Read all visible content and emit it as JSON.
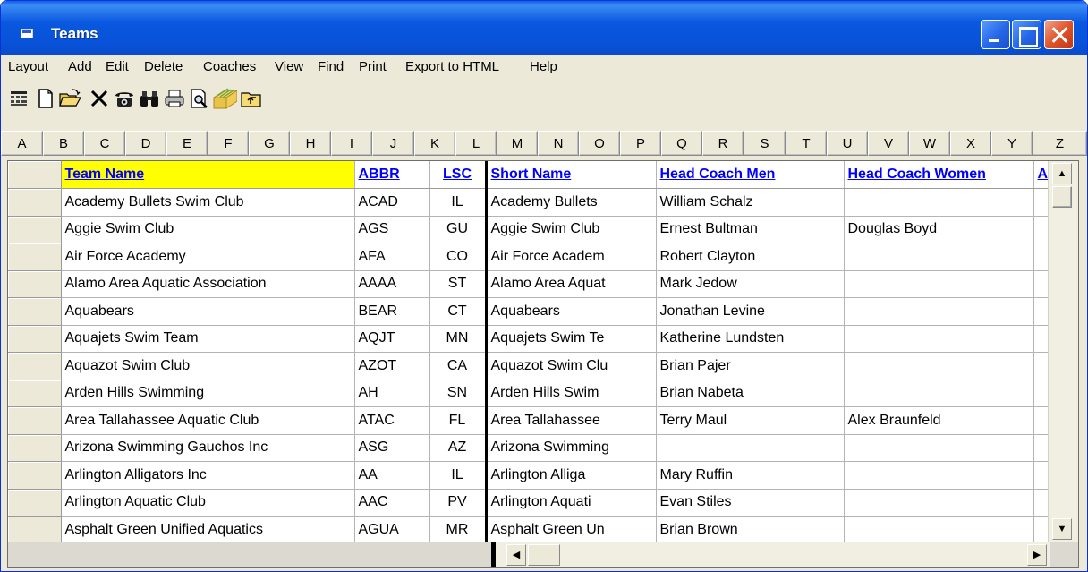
{
  "window": {
    "title": "Teams",
    "colors": {
      "title_bar": "#0a58e0",
      "sorted_header": "#ffff00",
      "header_link": "#0000ff",
      "close_button": "#e0552c"
    }
  },
  "menu": [
    "Layout",
    "Add",
    "Edit",
    "Delete",
    "Coaches",
    "View",
    "Find",
    "Print",
    "Export to HTML",
    "Help"
  ],
  "toolbar": {
    "icons": [
      "grid-layout-icon",
      "new-document-icon",
      "open-folder-icon",
      "delete-x-icon",
      "telephone-icon",
      "binoculars-find-icon",
      "printer-icon",
      "print-preview-icon",
      "export-html-icon",
      "up-folder-icon"
    ]
  },
  "letters": [
    "A",
    "B",
    "C",
    "D",
    "E",
    "F",
    "G",
    "H",
    "I",
    "J",
    "K",
    "L",
    "M",
    "N",
    "O",
    "P",
    "Q",
    "R",
    "S",
    "T",
    "U",
    "V",
    "W",
    "X",
    "Y",
    "Z"
  ],
  "table": {
    "columns": [
      "Team Name",
      "ABBR",
      "LSC",
      "Short Name",
      "Head Coach Men",
      "Head Coach Women",
      "A"
    ],
    "sorted_column": "Team Name",
    "rows": [
      [
        "Academy Bullets Swim Club",
        "ACAD",
        "IL",
        "Academy Bullets",
        "William Schalz",
        ""
      ],
      [
        "Aggie Swim Club",
        "AGS",
        "GU",
        "Aggie Swim Club",
        "Ernest Bultman",
        "Douglas Boyd"
      ],
      [
        "Air Force Academy",
        "AFA",
        "CO",
        "Air Force Academ",
        "Robert Clayton",
        ""
      ],
      [
        "Alamo Area Aquatic Association",
        "AAAA",
        "ST",
        "Alamo Area Aquat",
        "Mark Jedow",
        ""
      ],
      [
        "Aquabears",
        "BEAR",
        "CT",
        "Aquabears",
        "Jonathan Levine",
        ""
      ],
      [
        "Aquajets Swim Team",
        "AQJT",
        "MN",
        "Aquajets Swim Te",
        "Katherine Lundsten",
        ""
      ],
      [
        "Aquazot Swim Club",
        "AZOT",
        "CA",
        "Aquazot Swim Clu",
        "Brian Pajer",
        ""
      ],
      [
        "Arden Hills Swimming",
        "AH",
        "SN",
        "Arden Hills Swim",
        "Brian Nabeta",
        ""
      ],
      [
        "Area Tallahassee Aquatic Club",
        "ATAC",
        "FL",
        "Area Tallahassee",
        "Terry Maul",
        "Alex Braunfeld"
      ],
      [
        "Arizona Swimming Gauchos Inc",
        "ASG",
        "AZ",
        "Arizona Swimming",
        "",
        ""
      ],
      [
        "Arlington Alligators Inc",
        "AA",
        "IL",
        "Arlington Alliga",
        "Mary Ruffin",
        ""
      ],
      [
        "Arlington Aquatic Club",
        "AAC",
        "PV",
        "Arlington Aquati",
        "Evan Stiles",
        ""
      ],
      [
        "Asphalt Green Unified Aquatics",
        "AGUA",
        "MR",
        "Asphalt Green Un",
        "Brian Brown",
        ""
      ]
    ]
  }
}
